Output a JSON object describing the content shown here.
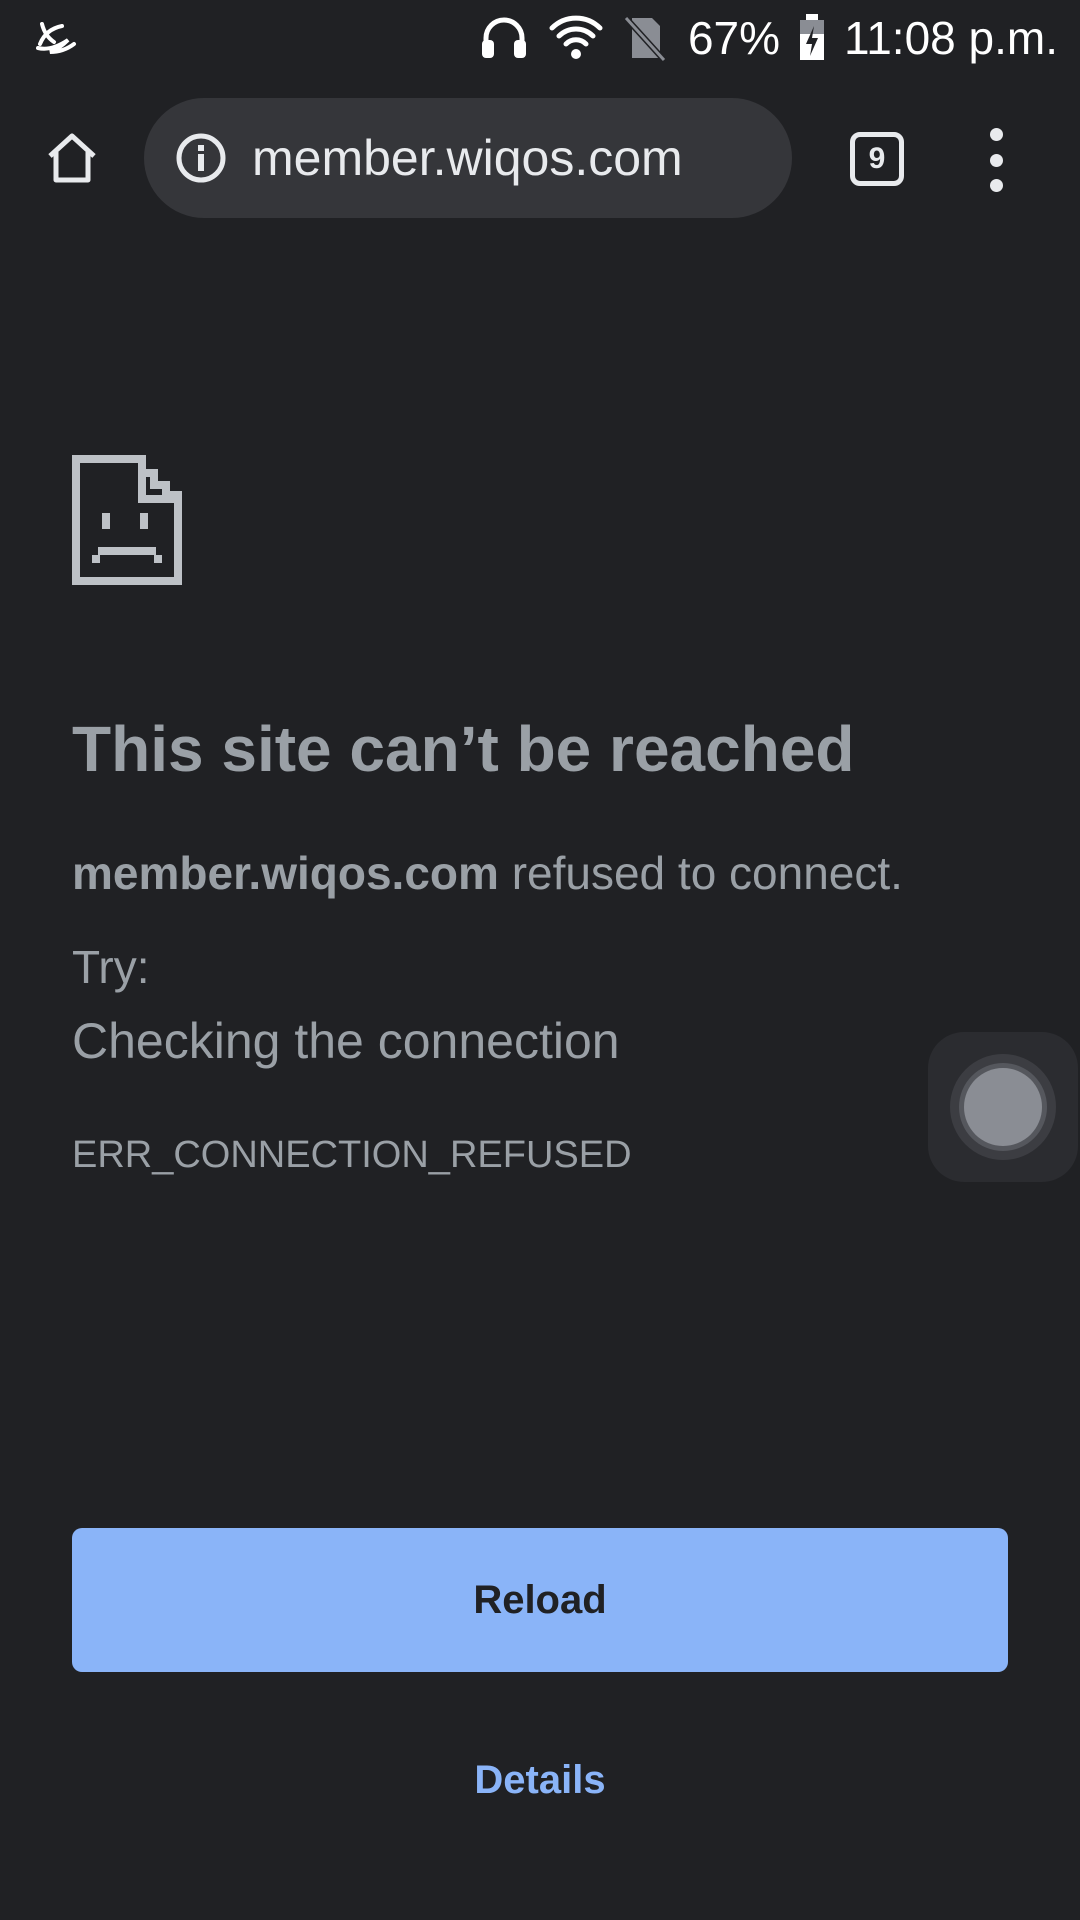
{
  "status_bar": {
    "left_icon": "swift-keyboard-icon",
    "icons": [
      "headphones-icon",
      "wifi-icon",
      "no-sim-icon"
    ],
    "battery_percent": "67%",
    "battery_icon": "battery-charging-icon",
    "time": "11:08 p.m."
  },
  "toolbar": {
    "home_icon": "home-icon",
    "info_icon": "info-icon",
    "url": "member.wiqos.com",
    "tab_count": "9",
    "menu_icon": "more-vert-icon"
  },
  "error": {
    "icon": "sad-page-icon",
    "title": "This site can’t be reached",
    "host": "member.wiqos.com",
    "summary_suffix": " refused to connect.",
    "try_label": "Try:",
    "suggestion": "Checking the connection",
    "code": "ERR_CONNECTION_REFUSED"
  },
  "actions": {
    "reload_label": "Reload",
    "details_label": "Details"
  },
  "colors": {
    "background": "#202124",
    "omnibox": "#35363a",
    "text_secondary": "#9aa0a6",
    "accent_blue": "#8ab4f8"
  }
}
